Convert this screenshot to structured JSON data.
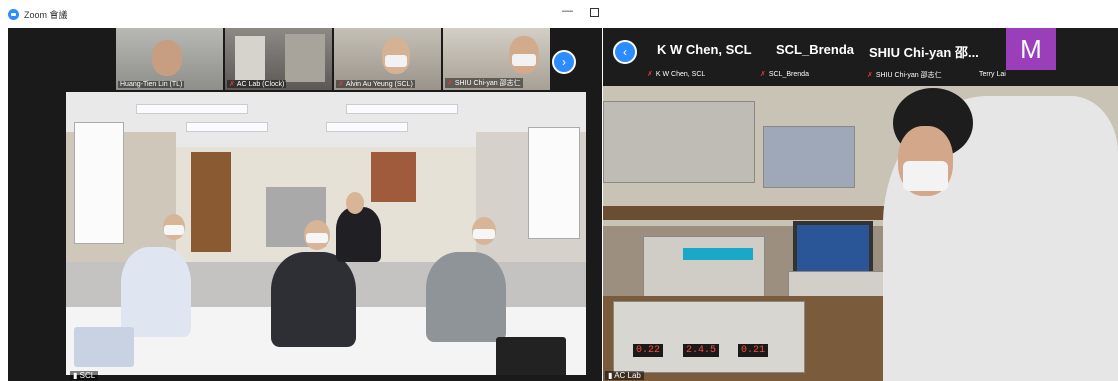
{
  "window": {
    "app_title": "Zoom 會議",
    "minimize_glyph": "—"
  },
  "left": {
    "participants": [
      {
        "name": "Huang-Tien Lin (TL)",
        "muted": false
      },
      {
        "name": "AC Lab (Clock)",
        "muted": true
      },
      {
        "name": "Alvin Au Yeung (SCL)",
        "muted": true
      },
      {
        "name": "SHIU Chi-yan 邵志仁",
        "muted": true
      }
    ],
    "next_glyph": "›",
    "main_label": "SCL"
  },
  "right": {
    "prev_glyph": "‹",
    "participants": [
      {
        "title": "K W Chen, SCL",
        "name": "K W Chen, SCL"
      },
      {
        "title": "SCL_Brenda",
        "name": "SCL_Brenda"
      },
      {
        "title": "SHIU Chi-yan 邵...",
        "name": "SHIU Chi-yan 邵志仁"
      }
    ],
    "avatar_letter": "M",
    "avatar_name": "Terry Lai",
    "main_label": "AC Lab",
    "readouts": [
      "0.22",
      "2.4.5",
      "0.21"
    ]
  },
  "colors": {
    "accent": "#2d8cff",
    "muted": "#e03a3a",
    "avatar": "#9b3eb9"
  },
  "icons": {
    "app": "zoom-icon",
    "mute": "mic-muted-icon",
    "signal": "signal-icon"
  }
}
